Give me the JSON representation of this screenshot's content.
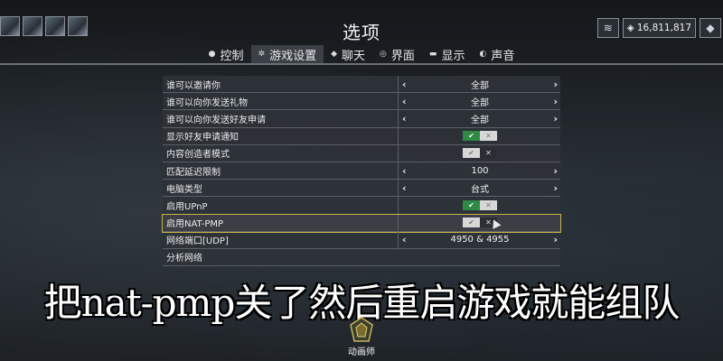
{
  "title": "选项",
  "tabs": [
    {
      "label": "控制",
      "icon": "mouse-icon"
    },
    {
      "label": "游戏设置",
      "icon": "gear-icon"
    },
    {
      "label": "聊天",
      "icon": "chat-icon"
    },
    {
      "label": "界面",
      "icon": "interface-icon"
    },
    {
      "label": "显示",
      "icon": "display-icon"
    },
    {
      "label": "声音",
      "icon": "speaker-icon"
    }
  ],
  "resources": {
    "credits": "16,811,817"
  },
  "settings": [
    {
      "label": "谁可以邀请你",
      "type": "select",
      "value": "全部"
    },
    {
      "label": "谁可以向你发送礼物",
      "type": "select",
      "value": "全部"
    },
    {
      "label": "谁可以向你发送好友申请",
      "type": "select",
      "value": "全部"
    },
    {
      "label": "显示好友申请通知",
      "type": "toggle",
      "value": "on"
    },
    {
      "label": "内容创造者模式",
      "type": "toggle",
      "value": "off"
    },
    {
      "label": "匹配延迟限制",
      "type": "select",
      "value": "100"
    },
    {
      "label": "电脑类型",
      "type": "select",
      "value": "台式"
    },
    {
      "label": "启用UPnP",
      "type": "toggle",
      "value": "on"
    },
    {
      "label": "启用NAT-PMP",
      "type": "toggle",
      "value": "off"
    },
    {
      "label": "网络端口[UDP]",
      "type": "select",
      "value": "4950 & 4955"
    },
    {
      "label": "分析网络",
      "type": "action",
      "value": ""
    }
  ],
  "caption": "把nat-pmp关了然后重启游戏就能组队",
  "badge": {
    "title": "动画师"
  }
}
